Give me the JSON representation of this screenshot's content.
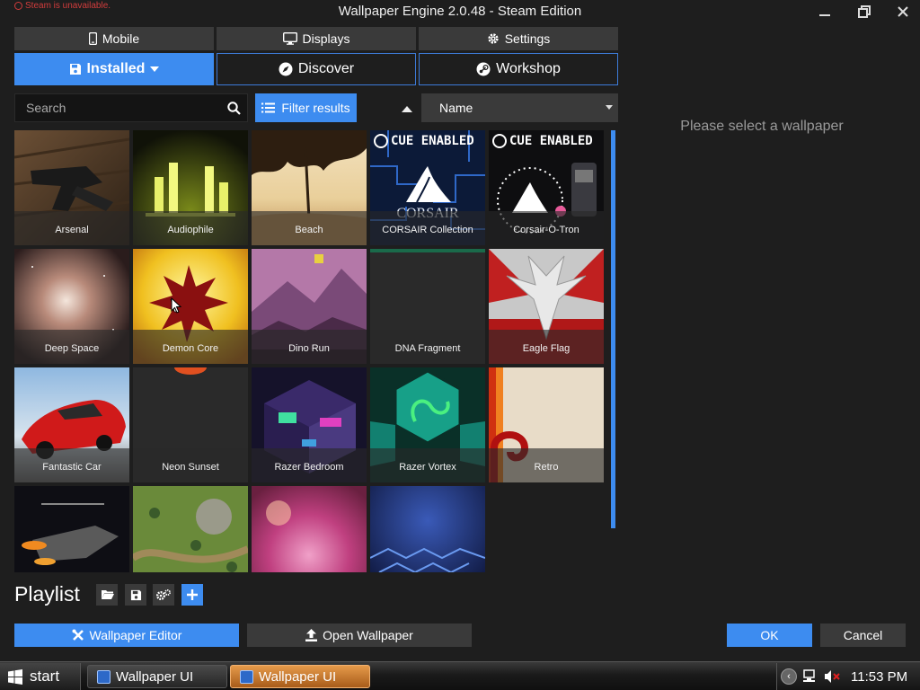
{
  "window": {
    "status": "Steam is unavailable.",
    "title": "Wallpaper Engine 2.0.48 - Steam Edition"
  },
  "top_tabs": [
    {
      "label": "Mobile",
      "icon": "phone-icon"
    },
    {
      "label": "Displays",
      "icon": "monitor-icon"
    },
    {
      "label": "Settings",
      "icon": "gear-icon"
    }
  ],
  "main_tabs": [
    {
      "label": "Installed",
      "icon": "save-icon",
      "active": true
    },
    {
      "label": "Discover",
      "icon": "compass-icon"
    },
    {
      "label": "Workshop",
      "icon": "steam-icon"
    }
  ],
  "toolbar": {
    "search_placeholder": "Search",
    "filter_label": "Filter results",
    "sort_value": "Name"
  },
  "wallpapers": [
    {
      "name": "Arsenal"
    },
    {
      "name": "Audiophile"
    },
    {
      "name": "Beach"
    },
    {
      "name": "CORSAIR Collection",
      "badge": "CUE ENABLED"
    },
    {
      "name": "Corsair-O-Tron",
      "badge": "CUE ENABLED"
    },
    {
      "name": "Deep Space"
    },
    {
      "name": "Demon Core"
    },
    {
      "name": "Dino Run"
    },
    {
      "name": "DNA Fragment"
    },
    {
      "name": "Eagle Flag"
    },
    {
      "name": "Fantastic Car"
    },
    {
      "name": "Neon Sunset"
    },
    {
      "name": "Razer Bedroom"
    },
    {
      "name": "Razer Vortex"
    },
    {
      "name": "Retro"
    },
    {
      "name": ""
    },
    {
      "name": ""
    },
    {
      "name": ""
    },
    {
      "name": ""
    }
  ],
  "corsair_logo": "CORSAIR",
  "preview": {
    "empty_text": "Please select a wallpaper"
  },
  "playlist": {
    "title": "Playlist"
  },
  "bottom": {
    "editor": "Wallpaper Editor",
    "open": "Open Wallpaper",
    "ok": "OK",
    "cancel": "Cancel"
  },
  "taskbar": {
    "start": "start",
    "items": [
      "Wallpaper UI",
      "Wallpaper UI"
    ],
    "clock": "11:53 PM"
  },
  "colors": {
    "accent": "#3d8cf0",
    "background": "#1e1e1e",
    "button": "#3a3a3a"
  }
}
